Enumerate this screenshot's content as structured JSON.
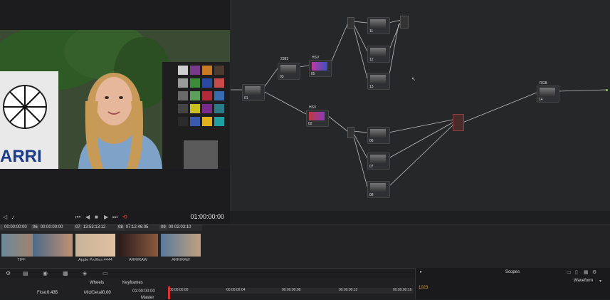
{
  "viewer": {
    "timecode": "01:00:00:00",
    "logo_text": "ARRI"
  },
  "transport": {
    "prev_label": "⏮",
    "back_label": "◀",
    "stop_label": "■",
    "play_label": "▶",
    "next_label": "⏭",
    "loop_label": "⟲"
  },
  "nodes": [
    {
      "label": "01",
      "title": ""
    },
    {
      "label": "03",
      "title": "2383"
    },
    {
      "label": "05",
      "title": "HSV"
    },
    {
      "label": "11",
      "title": ""
    },
    {
      "label": "12",
      "title": ""
    },
    {
      "label": "13",
      "title": ""
    },
    {
      "label": "02",
      "title": "HSV"
    },
    {
      "label": "06",
      "title": ""
    },
    {
      "label": "07",
      "title": ""
    },
    {
      "label": "08",
      "title": ""
    },
    {
      "label": "14",
      "title": "RGB"
    }
  ],
  "clips": [
    {
      "num": "",
      "tc": "00:00:00:00",
      "name": "TIFF"
    },
    {
      "num": "06",
      "tc": "00:00:00:00",
      "name": ""
    },
    {
      "num": "07",
      "tc": "13:53:13:12",
      "name": "Apple ProRes 4444"
    },
    {
      "num": "08",
      "tc": "07:12:46:05",
      "name": "ARRIRAW"
    },
    {
      "num": "09",
      "tc": "00:02:03:10",
      "name": "ARRIRAW"
    }
  ],
  "panels": {
    "wheels_label": "Wheels",
    "keyframes_label": "Keyframes",
    "scopes_label": "Scopes",
    "waveform_label": "Waveform",
    "master_label": "Master",
    "kf_timecode": "01:00:00:00",
    "ruler": [
      "00:00:00:00",
      "00:00:00:04",
      "00:00:00:08",
      "00:00:00:12",
      "00:00:00:16"
    ],
    "contrast_label": "Float",
    "contrast_value": "0.435",
    "mid_detail_label": "Mid/Detail",
    "mid_detail_value": "0.00",
    "scope_value": "1023"
  }
}
